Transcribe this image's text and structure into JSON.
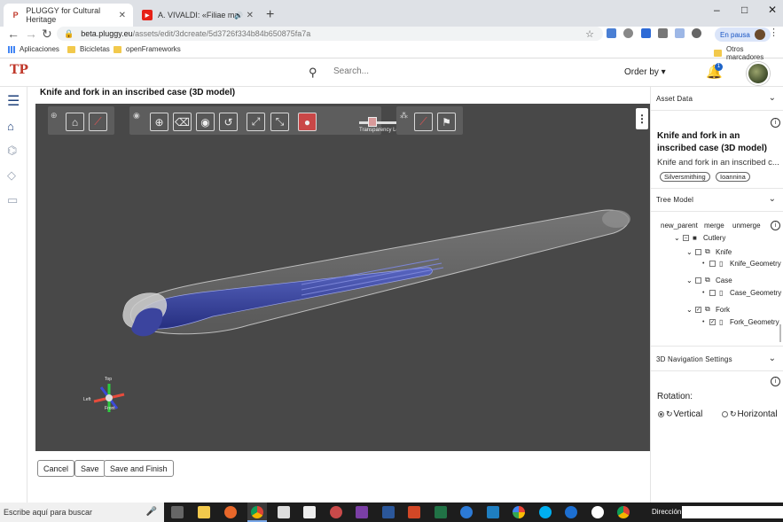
{
  "browser": {
    "tabs": [
      {
        "title": "PLUGGY for Cultural Heritage",
        "active": true
      },
      {
        "title": "A. VIVALDI: «Filiae maestae",
        "active": false
      }
    ],
    "new_tab": "+",
    "window_controls": [
      "–",
      "□",
      "✕"
    ],
    "url_host": "beta.pluggy.eu",
    "url_path": "/assets/edit/3dcreate/5d3726f334b84b650875fa7a",
    "profile_status": "En pausa",
    "bookmarks": [
      "Aplicaciones",
      "Bicicletas",
      "openFrameworks"
    ],
    "other_bookmarks": "Otros marcadores"
  },
  "header": {
    "search_placeholder": "Search...",
    "order_by": "Order by ▾",
    "notification_count": "1"
  },
  "page": {
    "title": "Knife and fork in an inscribed case (3D model)"
  },
  "viewer": {
    "transparency_label": "Transparency Level",
    "transparency_level": 0.2,
    "axis_labels": {
      "top": "Top",
      "left": "Left",
      "front": "Front"
    },
    "background_color": "#484848",
    "model_color": "#3a4aa8"
  },
  "actions": {
    "cancel": "Cancel",
    "save": "Save",
    "save_finish": "Save and Finish"
  },
  "panel": {
    "asset_data": {
      "heading": "Asset Data",
      "title": "Knife and fork in an inscribed case (3D model)",
      "description": "Knife and fork in an inscribed c...",
      "tags": [
        "Silversmithing",
        "Ioannina"
      ]
    },
    "tree_model": {
      "heading": "Tree Model",
      "actions": [
        "new_parent",
        "merge",
        "unmerge"
      ],
      "nodes": [
        {
          "label": "Cutlery",
          "level": 0,
          "checked": "partial",
          "kind": "folder"
        },
        {
          "label": "Knife",
          "level": 1,
          "checked": false,
          "kind": "group"
        },
        {
          "label": "Knife_Geometry",
          "level": 2,
          "checked": false,
          "kind": "file"
        },
        {
          "label": "Case",
          "level": 1,
          "checked": false,
          "kind": "group"
        },
        {
          "label": "Case_Geometry",
          "level": 2,
          "checked": false,
          "kind": "file"
        },
        {
          "label": "Fork",
          "level": 1,
          "checked": true,
          "kind": "group"
        },
        {
          "label": "Fork_Geometry",
          "level": 2,
          "checked": true,
          "kind": "file"
        }
      ]
    },
    "nav_settings": {
      "heading": "3D Navigation Settings",
      "rotation_label": "Rotation:",
      "options": [
        "Vertical",
        "Horizontal"
      ],
      "selected": "Vertical"
    }
  },
  "taskbar": {
    "search_placeholder": "Escribe aquí para buscar",
    "address_label": "Dirección"
  }
}
